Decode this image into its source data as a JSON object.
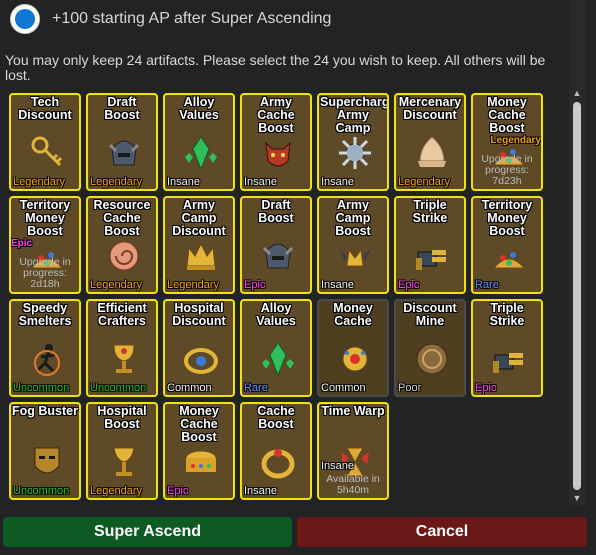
{
  "option": {
    "text": "+100 starting AP after Super Ascending",
    "selected": true
  },
  "instructions": "You may only keep 24 artifacts.  Please select the 24 you wish to keep.  All others will be lost.",
  "artifacts": [
    {
      "name": "Tech Discount",
      "rarity": "Legendary",
      "icon": "golden-key-icon",
      "selected": true
    },
    {
      "name": "Draft Boost",
      "rarity": "Legendary",
      "icon": "horned-helmet-icon",
      "selected": true
    },
    {
      "name": "Alloy Values",
      "rarity": "Insane",
      "icon": "green-crystal-icon",
      "selected": true
    },
    {
      "name": "Army Cache Boost",
      "rarity": "Insane",
      "icon": "red-demon-mask-icon",
      "selected": true
    },
    {
      "name": "Supercharge Army Camp",
      "rarity": "Insane",
      "icon": "spiked-disc-icon",
      "selected": true
    },
    {
      "name": "Mercenary Discount",
      "rarity": "Legendary",
      "icon": "cream-shell-icon",
      "selected": true
    },
    {
      "name": "Money Cache Boost",
      "rarity": "Legendary",
      "icon": "treasure-pile-icon",
      "selected": true,
      "status": "Upgrade in progress: 7d23h"
    },
    {
      "name": "Territory Money Boost",
      "rarity": "Epic",
      "icon": "treasure-pile-icon",
      "selected": true,
      "status": "Upgrade in progress: 2d18h"
    },
    {
      "name": "Resource Cache Boost",
      "rarity": "Legendary",
      "icon": "spiral-shell-icon",
      "selected": true
    },
    {
      "name": "Army Camp Discount",
      "rarity": "Legendary",
      "icon": "gold-crown-icon",
      "selected": true
    },
    {
      "name": "Draft Boost",
      "rarity": "Epic",
      "icon": "horned-helmet-icon",
      "selected": true
    },
    {
      "name": "Army Camp Boost",
      "rarity": "Insane",
      "icon": "winged-crown-icon",
      "selected": true
    },
    {
      "name": "Triple Strike",
      "rarity": "Epic",
      "icon": "triple-cannon-icon",
      "selected": true
    },
    {
      "name": "Territory Money Boost",
      "rarity": "Rare",
      "icon": "treasure-pile-icon",
      "selected": true
    },
    {
      "name": "Speedy Smelters",
      "rarity": "Uncommon",
      "icon": "running-figure-icon",
      "selected": true
    },
    {
      "name": "Efficient Crafters",
      "rarity": "Uncommon",
      "icon": "jeweled-chalice-icon",
      "selected": true
    },
    {
      "name": "Hospital Discount",
      "rarity": "Common",
      "icon": "jeweled-ring-icon",
      "selected": true
    },
    {
      "name": "Alloy Values",
      "rarity": "Rare",
      "icon": "green-crystal-icon",
      "selected": true
    },
    {
      "name": "Money Cache",
      "rarity": "Common",
      "icon": "gold-brooch-icon",
      "selected": false
    },
    {
      "name": "Discount Mine",
      "rarity": "Poor",
      "icon": "bronze-medallion-icon",
      "selected": false
    },
    {
      "name": "Triple Strike",
      "rarity": "Epic",
      "icon": "triple-cannon-icon",
      "selected": true
    },
    {
      "name": "Fog Buster",
      "rarity": "Uncommon",
      "icon": "tribal-mask-icon",
      "selected": true
    },
    {
      "name": "Hospital Boost",
      "rarity": "Legendary",
      "icon": "gold-goblet-icon",
      "selected": true
    },
    {
      "name": "Money Cache Boost",
      "rarity": "Epic",
      "icon": "jeweled-coin-chest-icon",
      "selected": true
    },
    {
      "name": "Cache Boost",
      "rarity": "Insane",
      "icon": "gold-ring-icon",
      "selected": true
    },
    {
      "name": "Time Warp",
      "rarity": "Insane",
      "icon": "winged-hourglass-icon",
      "selected": true,
      "status": "Available in 5h40m"
    }
  ],
  "buttons": {
    "ascend": "Super Ascend",
    "cancel": "Cancel"
  },
  "colors": {
    "legendary": "#f2a10a",
    "insane": "#f2f2f2",
    "epic": "#ff3df5",
    "rare": "#5b8dff",
    "uncommon": "#19c21c",
    "common": "#f2f2f2",
    "poor": "#cfcfcf",
    "selected_border": "#f0e20a",
    "ascend_button": "#0d5a22",
    "cancel_button": "#6b1818"
  }
}
